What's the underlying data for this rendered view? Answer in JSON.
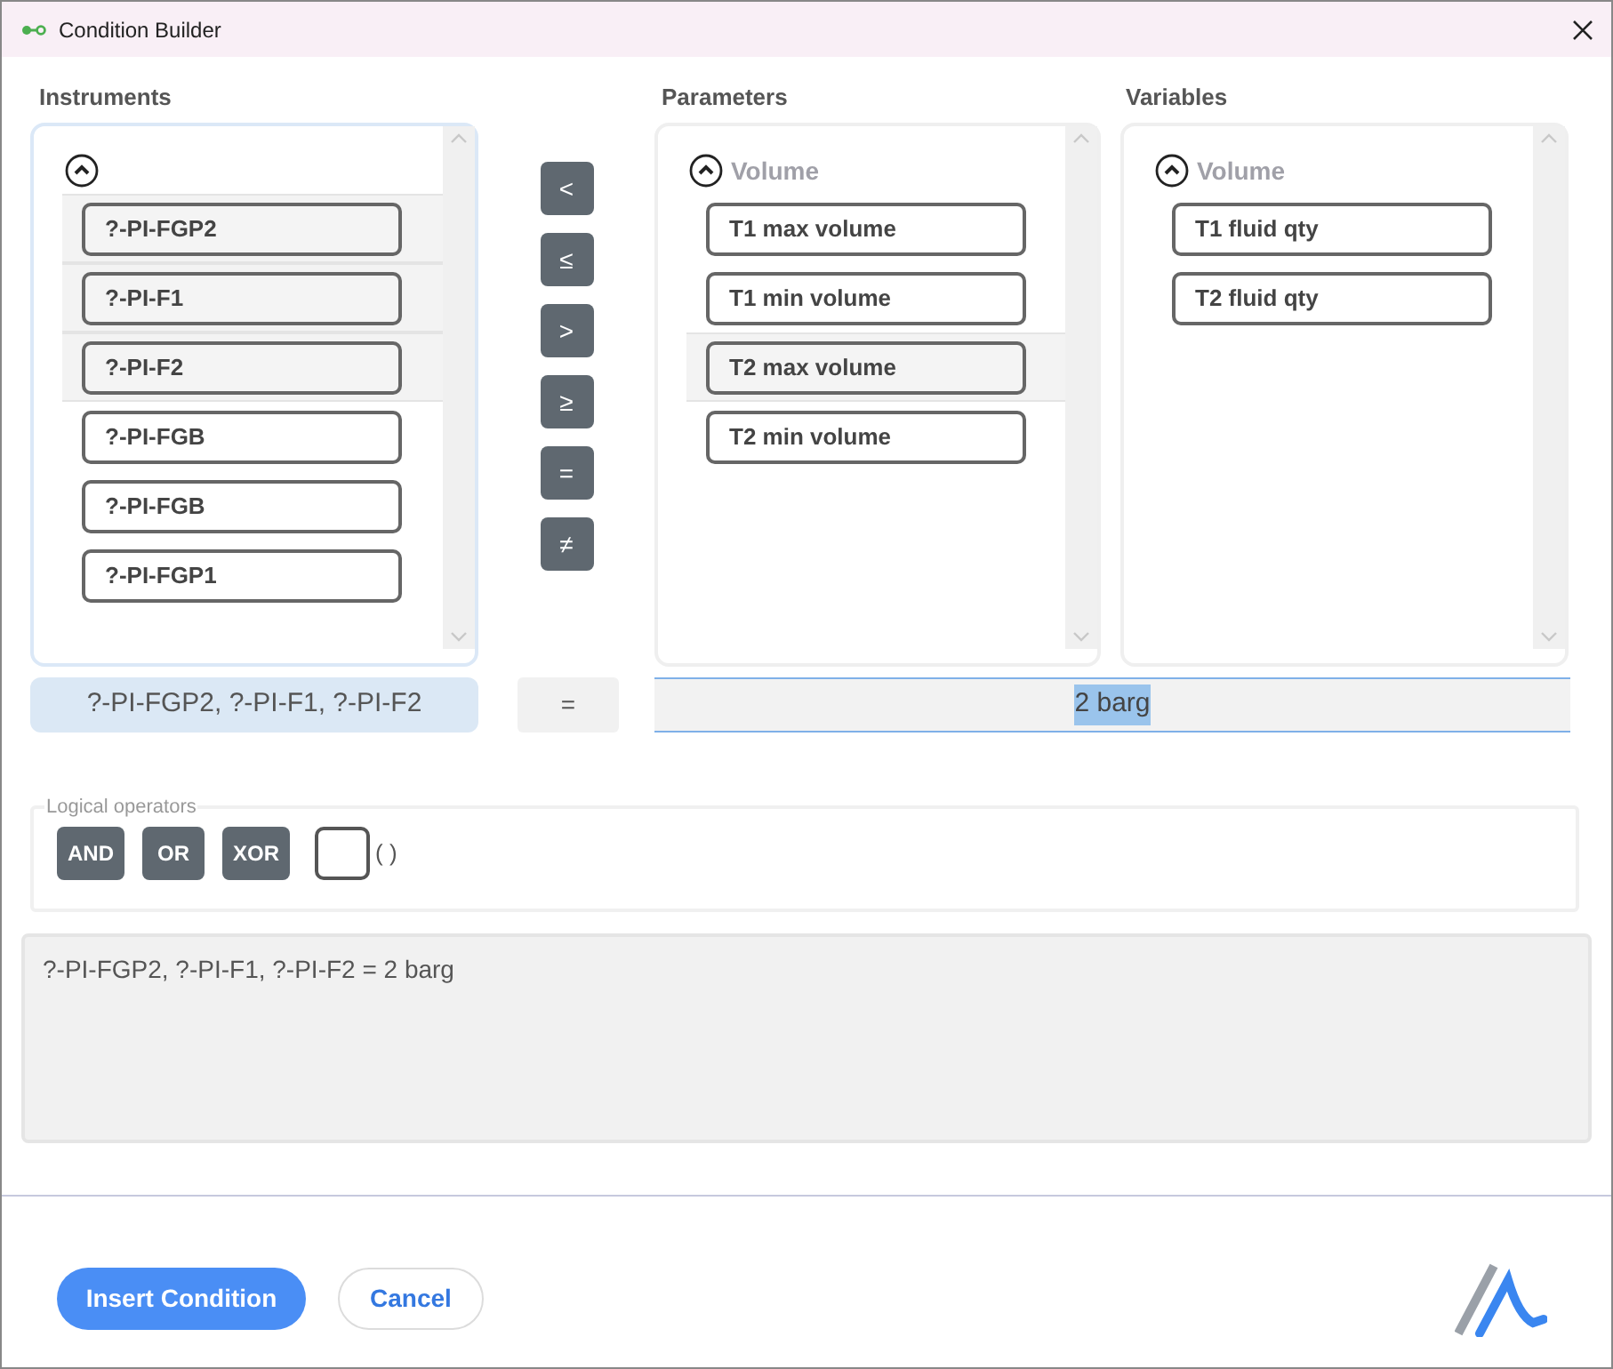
{
  "window": {
    "title": "Condition Builder"
  },
  "instruments": {
    "heading": "Instruments",
    "expanded": true,
    "items": [
      {
        "label": "?-PI-FGP2",
        "selected": true
      },
      {
        "label": "?-PI-F1",
        "selected": true
      },
      {
        "label": "?-PI-F2",
        "selected": true
      },
      {
        "label": "?-PI-FGB",
        "selected": false
      },
      {
        "label": "?-PI-FGB",
        "selected": false
      },
      {
        "label": "?-PI-FGP1",
        "selected": false
      }
    ]
  },
  "operators": [
    "<",
    "≤",
    ">",
    "≥",
    "=",
    "≠"
  ],
  "parameters": {
    "heading": "Parameters",
    "group": "Volume",
    "expanded": true,
    "items": [
      {
        "label": "T1 max volume",
        "selected": false
      },
      {
        "label": "T1 min volume",
        "selected": false
      },
      {
        "label": "T2 max volume",
        "selected": true
      },
      {
        "label": "T2 min volume",
        "selected": false
      }
    ]
  },
  "variables": {
    "heading": "Variables",
    "group": "Volume",
    "expanded": true,
    "items": [
      {
        "label": "T1 fluid qty",
        "selected": false
      },
      {
        "label": "T2 fluid qty",
        "selected": false
      }
    ]
  },
  "selection": {
    "instruments": "?-PI-FGP2, ?-PI-F1, ?-PI-F2",
    "operator": "=",
    "value": "2 barg"
  },
  "logical": {
    "legend": "Logical operators",
    "buttons": [
      "AND",
      "OR",
      "XOR"
    ],
    "grouping_checked": false,
    "grouping_label": "( )"
  },
  "expression": "?-PI-FGP2, ?-PI-F1, ?-PI-F2 = 2 barg",
  "footer": {
    "primary": "Insert Condition",
    "secondary": "Cancel"
  }
}
